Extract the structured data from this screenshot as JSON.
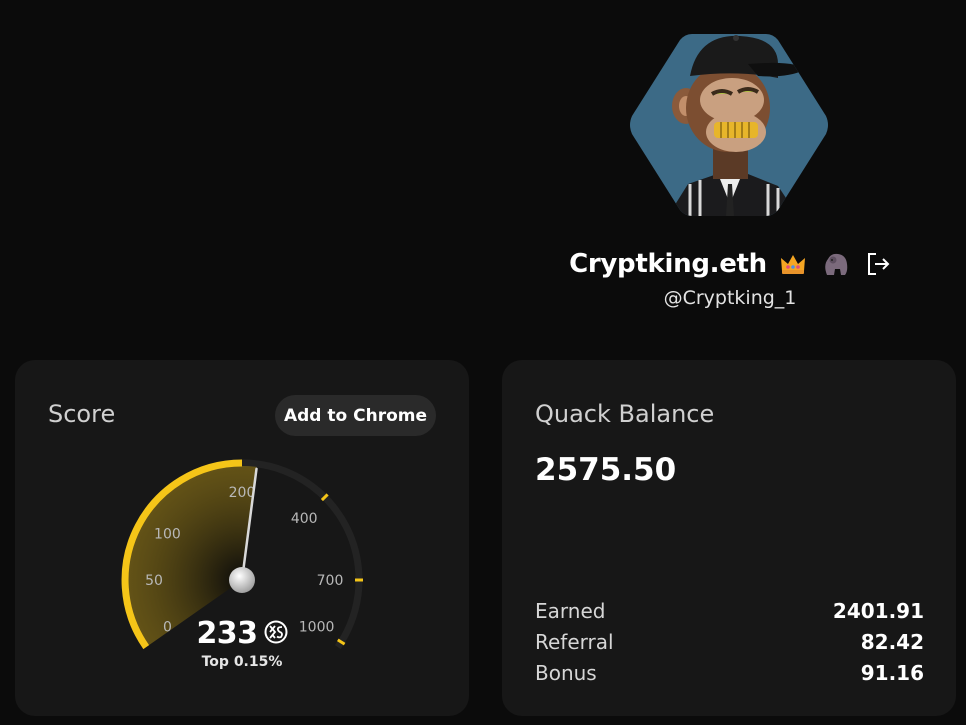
{
  "profile": {
    "display_name": "Cryptking.eth",
    "handle": "@Cryptking_1",
    "avatar_icon": "ape-nft-avatar",
    "badges": [
      "crown-icon",
      "gorilla-icon"
    ],
    "logout_icon": "logout-icon"
  },
  "score_card": {
    "title": "Score",
    "add_to_chrome_label": "Add to Chrome",
    "score": "233",
    "score_icon": "xs-logo-icon",
    "rank": "Top 0.15%",
    "gauge": {
      "value": 233,
      "ticks": [
        "0",
        "50",
        "100",
        "200",
        "400",
        "700",
        "1000"
      ],
      "accent_color": "#f5c518"
    }
  },
  "balance_card": {
    "title": "Quack Balance",
    "balance": "2575.50",
    "rows": [
      {
        "label": "Earned",
        "value": "2401.91"
      },
      {
        "label": "Referral",
        "value": "82.42"
      },
      {
        "label": "Bonus",
        "value": "91.16"
      }
    ]
  }
}
